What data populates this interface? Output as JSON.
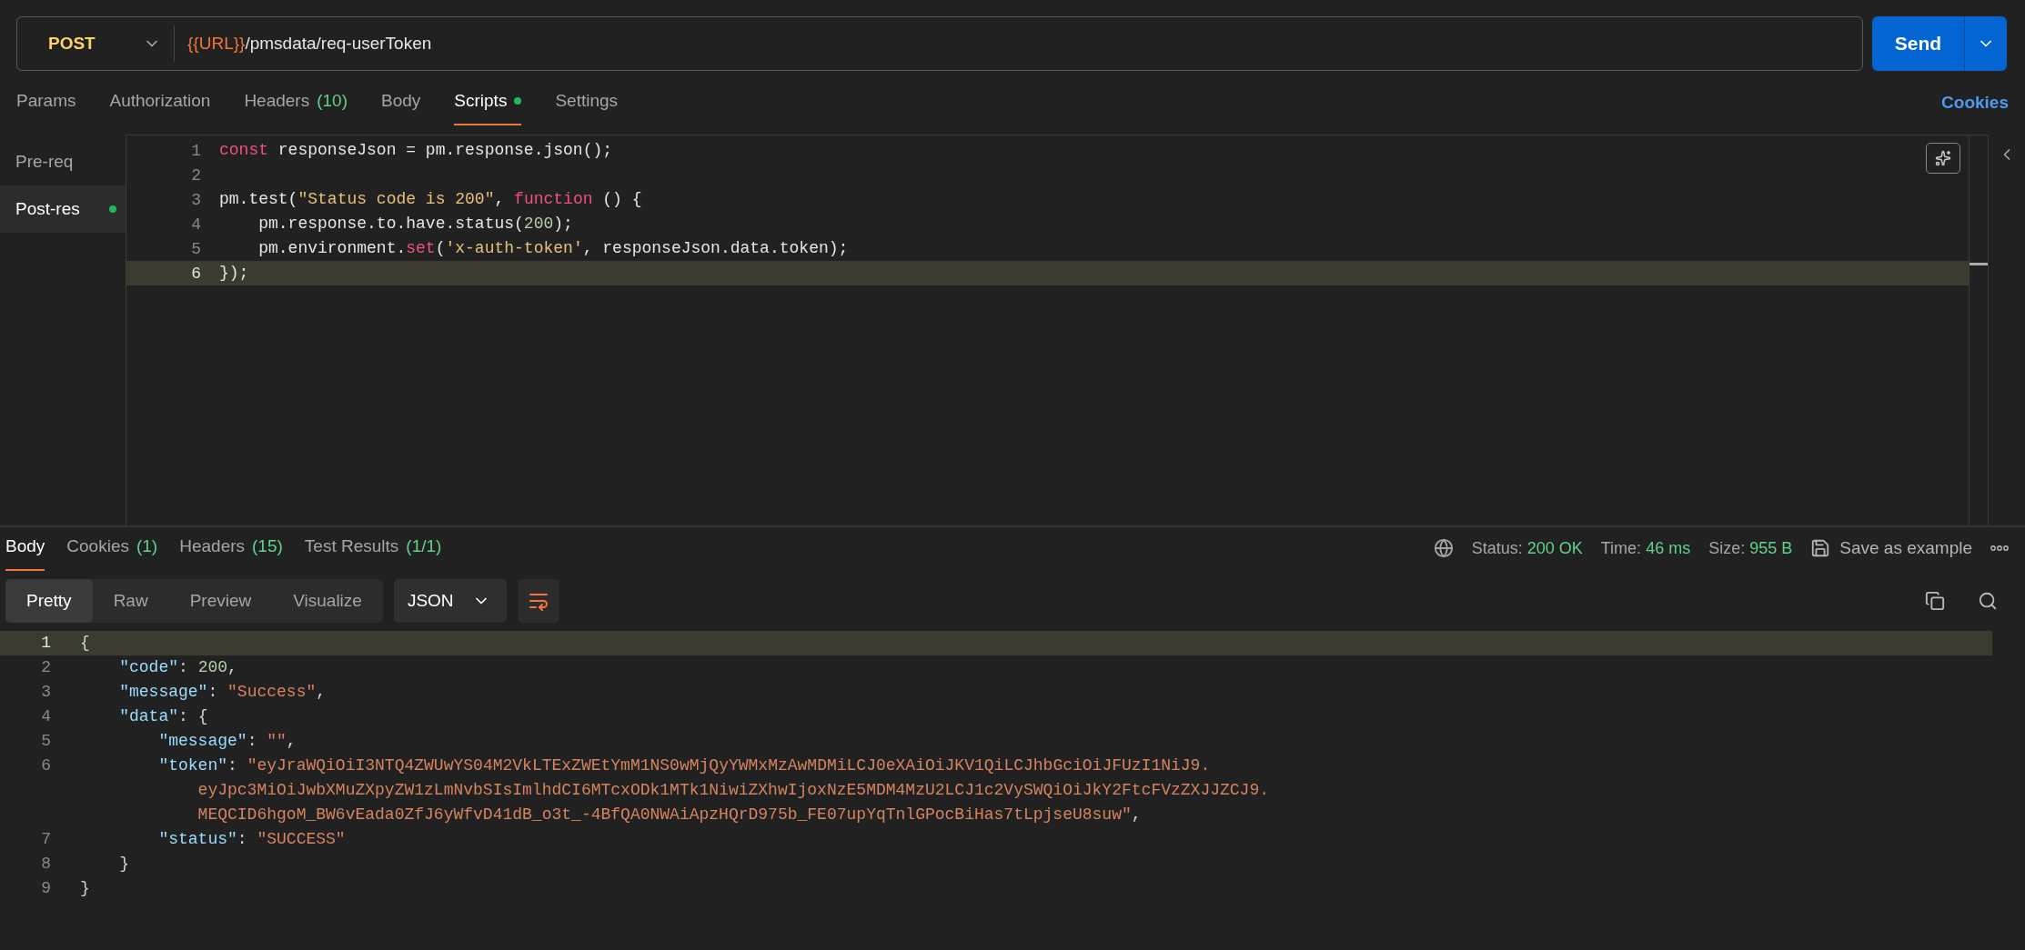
{
  "request": {
    "method": "POST",
    "url": [
      {
        "text": "{{URL}}",
        "kind": "variable"
      },
      {
        "text": "/pmsdata/req-userToken",
        "kind": "path"
      }
    ],
    "send": "Send"
  },
  "request_tabs": [
    {
      "label": "Params",
      "selected": false,
      "dot": false
    },
    {
      "label": "Authorization",
      "selected": false,
      "dot": false
    },
    {
      "label": "Headers",
      "count": "(10)",
      "selected": false,
      "dot": false
    },
    {
      "label": "Body",
      "selected": false,
      "dot": false
    },
    {
      "label": "Scripts",
      "selected": true,
      "dot": true
    },
    {
      "label": "Settings",
      "selected": false,
      "dot": false
    }
  ],
  "cookies_link": "Cookies",
  "script_sidebar": [
    {
      "label": "Pre-req",
      "selected": false,
      "dot": false
    },
    {
      "label": "Post-res",
      "selected": true,
      "dot": true
    }
  ],
  "script_lines": [
    {
      "n": "1",
      "current": false,
      "tokens": [
        {
          "text": "const",
          "kind": "keyword"
        },
        {
          "text": " responseJson = pm.response.json();",
          "kind": "plain"
        }
      ]
    },
    {
      "n": "2",
      "current": false
    },
    {
      "n": "3",
      "current": false,
      "tokens": [
        {
          "text": "pm.test(",
          "kind": "plain"
        },
        {
          "text": "\"Status code is 200\"",
          "kind": "string"
        },
        {
          "text": ", ",
          "kind": "plain"
        },
        {
          "text": "function",
          "kind": "keyword"
        },
        {
          "text": " () {",
          "kind": "plain"
        }
      ]
    },
    {
      "n": "4",
      "current": false,
      "tokens": [
        {
          "text": "    pm.response.to.have.status(",
          "kind": "plain"
        },
        {
          "text": "200",
          "kind": "number"
        },
        {
          "text": ");",
          "kind": "plain"
        }
      ]
    },
    {
      "n": "5",
      "current": false,
      "tokens": [
        {
          "text": "    pm.environment.",
          "kind": "plain"
        },
        {
          "text": "set",
          "kind": "keyword"
        },
        {
          "text": "(",
          "kind": "plain"
        },
        {
          "text": "'x-auth-token'",
          "kind": "string"
        },
        {
          "text": ", responseJson.data.token);",
          "kind": "plain"
        }
      ]
    },
    {
      "n": "6",
      "current": true,
      "tokens": [
        {
          "text": "});",
          "kind": "plain"
        }
      ]
    }
  ],
  "response_tabs": [
    {
      "label": "Body",
      "selected": true
    },
    {
      "label": "Cookies",
      "count": "(1)",
      "selected": false
    },
    {
      "label": "Headers",
      "count": "(15)",
      "selected": false
    },
    {
      "label": "Test Results",
      "count": "(1/1)",
      "selected": false
    }
  ],
  "response_meta": [
    {
      "label": "Status:",
      "value": "200 OK"
    },
    {
      "label": "Time:",
      "value": "46 ms"
    },
    {
      "label": "Size:",
      "value": "955 B"
    }
  ],
  "save_example": "Save as example",
  "view_modes": [
    {
      "label": "Pretty",
      "selected": true
    },
    {
      "label": "Raw",
      "selected": false
    },
    {
      "label": "Preview",
      "selected": false
    },
    {
      "label": "Visualize",
      "selected": false
    }
  ],
  "format": "JSON",
  "response_lines": [
    {
      "n": "1",
      "current": true,
      "tokens": [
        {
          "text": "{",
          "kind": "punct"
        }
      ]
    },
    {
      "n": "2",
      "current": false,
      "tokens": [
        {
          "text": "    \"code\"",
          "kind": "key"
        },
        {
          "text": ": ",
          "kind": "punct"
        },
        {
          "text": "200",
          "kind": "number"
        },
        {
          "text": ",",
          "kind": "punct"
        }
      ]
    },
    {
      "n": "3",
      "current": false,
      "tokens": [
        {
          "text": "    \"message\"",
          "kind": "key"
        },
        {
          "text": ": ",
          "kind": "punct"
        },
        {
          "text": "\"Success\"",
          "kind": "string"
        },
        {
          "text": ",",
          "kind": "punct"
        }
      ]
    },
    {
      "n": "4",
      "current": false,
      "tokens": [
        {
          "text": "    \"data\"",
          "kind": "key"
        },
        {
          "text": ": {",
          "kind": "punct"
        }
      ]
    },
    {
      "n": "5",
      "current": false,
      "tokens": [
        {
          "text": "        \"message\"",
          "kind": "key"
        },
        {
          "text": ": ",
          "kind": "punct"
        },
        {
          "text": "\"\"",
          "kind": "string"
        },
        {
          "text": ",",
          "kind": "punct"
        }
      ]
    },
    {
      "n": "6",
      "current": false,
      "tokens": [
        {
          "text": "        \"token\"",
          "kind": "key"
        },
        {
          "text": ": ",
          "kind": "punct"
        },
        {
          "text": "\"eyJraWQiOiI3NTQ4ZWUwYS04M2VkLTExZWEtYmM1NS0wMjQyYWMxMzAwMDMiLCJ0eXAiOiJKV1QiLCJhbGciOiJFUzI1NiJ9.",
          "kind": "string"
        }
      ],
      "wrap": [
        [
          {
            "text": "eyJpc3MiOiJwbXMuZXpyZW1zLmNvbSIsImlhdCI6MTcxODk1MTk1NiwiZXhwIjoxNzE5MDM4MzU2LCJ1c2VySWQiOiJkY2FtcFVzZXJJZCJ9.",
            "kind": "string"
          }
        ],
        [
          {
            "text": "MEQCID6hgoM_BW6vEada0ZfJ6yWfvD41dB_o3t_-4BfQA0NWAiApzHQrD975b_FE07upYqTnlGPocBiHas7tLpjseU8suw\"",
            "kind": "string"
          },
          {
            "text": ",",
            "kind": "punct"
          }
        ]
      ]
    },
    {
      "n": "7",
      "current": false,
      "tokens": [
        {
          "text": "        \"status\"",
          "kind": "key"
        },
        {
          "text": ": ",
          "kind": "punct"
        },
        {
          "text": "\"SUCCESS\"",
          "kind": "string"
        }
      ]
    },
    {
      "n": "8",
      "current": false,
      "tokens": [
        {
          "text": "    }",
          "kind": "punct"
        }
      ]
    },
    {
      "n": "9",
      "current": false,
      "tokens": [
        {
          "text": "}",
          "kind": "punct"
        }
      ]
    }
  ]
}
